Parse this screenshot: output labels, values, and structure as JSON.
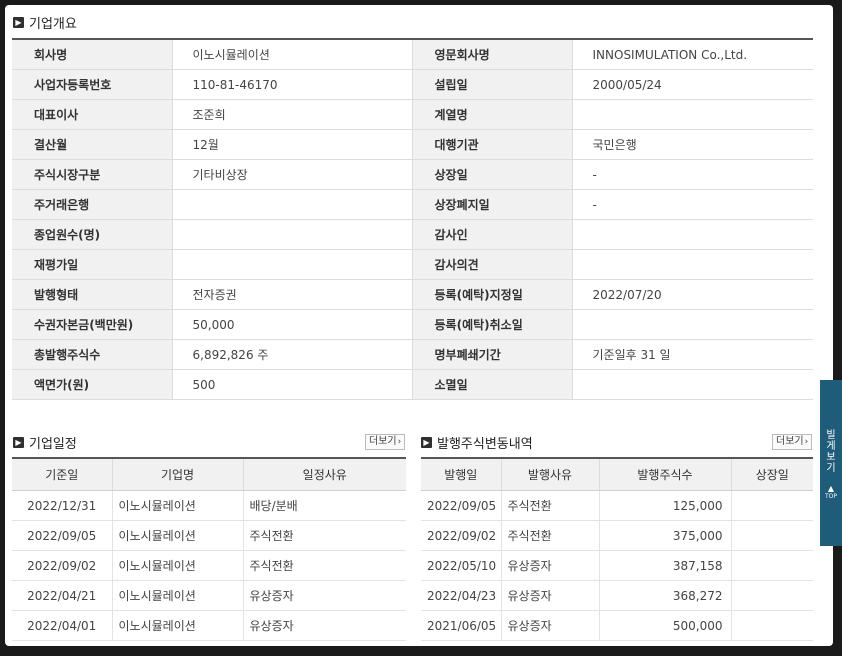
{
  "overview": {
    "title": "기업개요",
    "rows": [
      {
        "l1": "회사명",
        "v1": "이노시뮬레이션",
        "l2": "영문회사명",
        "v2": "INNOSIMULATION Co.,Ltd."
      },
      {
        "l1": "사업자등록번호",
        "v1": "110-81-46170",
        "l2": "설립일",
        "v2": "2000/05/24"
      },
      {
        "l1": "대표이사",
        "v1": "조준희",
        "l2": "계열명",
        "v2": ""
      },
      {
        "l1": "결산월",
        "v1": "12월",
        "l2": "대행기관",
        "v2": "국민은행"
      },
      {
        "l1": "주식시장구분",
        "v1": "기타비상장",
        "l2": "상장일",
        "v2": "-"
      },
      {
        "l1": "주거래은행",
        "v1": "",
        "l2": "상장폐지일",
        "v2": "-"
      },
      {
        "l1": "종업원수(명)",
        "v1": "",
        "l2": "감사인",
        "v2": ""
      },
      {
        "l1": "재평가일",
        "v1": "",
        "l2": "감사의견",
        "v2": ""
      },
      {
        "l1": "발행형태",
        "v1": "전자증권",
        "l2": "등록(예탁)지정일",
        "v2": "2022/07/20"
      },
      {
        "l1": "수권자본금(백만원)",
        "v1": "50,000",
        "l2": "등록(예탁)취소일",
        "v2": ""
      },
      {
        "l1": "총발행주식수",
        "v1": "6,892,826 주",
        "l2": "명부폐쇄기간",
        "v2": "기준일후 31 일"
      },
      {
        "l1": "액면가(원)",
        "v1": "500",
        "l2": "소멸일",
        "v2": ""
      }
    ]
  },
  "schedule": {
    "title": "기업일정",
    "more_label": "더보기",
    "headers": [
      "기준일",
      "기업명",
      "일정사유"
    ],
    "rows": [
      [
        "2022/12/31",
        "이노시뮬레이션",
        "배당/분배"
      ],
      [
        "2022/09/05",
        "이노시뮬레이션",
        "주식전환"
      ],
      [
        "2022/09/02",
        "이노시뮬레이션",
        "주식전환"
      ],
      [
        "2022/04/21",
        "이노시뮬레이션",
        "유상증자"
      ],
      [
        "2022/04/01",
        "이노시뮬레이션",
        "유상증자"
      ]
    ]
  },
  "issuance": {
    "title": "발행주식변동내역",
    "more_label": "더보기",
    "headers": [
      "발행일",
      "발행사유",
      "발행주식수",
      "상장일"
    ],
    "rows": [
      [
        "2022/09/05",
        "주식전환",
        "125,000",
        ""
      ],
      [
        "2022/09/02",
        "주식전환",
        "375,000",
        ""
      ],
      [
        "2022/05/10",
        "유상증자",
        "387,158",
        ""
      ],
      [
        "2022/04/23",
        "유상증자",
        "368,272",
        ""
      ],
      [
        "2021/06/05",
        "유상증자",
        "500,000",
        ""
      ]
    ]
  },
  "side_tab": {
    "label": "빌게보기",
    "top_label": "TOP"
  },
  "icons": {
    "section_marker": "triangle-right-icon",
    "more_chevron": "chevron-right-icon"
  },
  "colors": {
    "label_bg": "#f1f1f1",
    "border_dark": "#555555",
    "side_tab": "#1f5c7a"
  }
}
